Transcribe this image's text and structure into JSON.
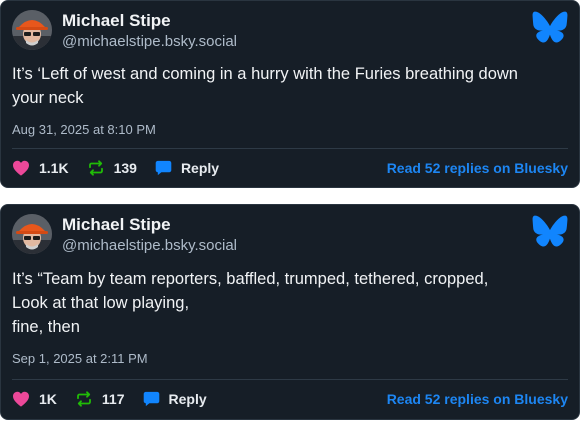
{
  "colors": {
    "card_background": "#161e27",
    "text": "#f1f3f5",
    "muted": "#aebbc9",
    "like": "#ec4899",
    "repost": "#20bc07",
    "reply": "#1185fe",
    "link": "#1d86f3",
    "bluesky_logo": "#1185fe"
  },
  "posts": [
    {
      "author": {
        "name": "Michael Stipe",
        "handle": "@michaelstipe.bsky.social"
      },
      "text_lines": [
        "It’s ‘Left of west and coming in a hurry with the Furies breathing down",
        "your neck"
      ],
      "timestamp": "Aug 31, 2025 at 8:10 PM",
      "likes": "1.1K",
      "reposts": "139",
      "reply_label": "Reply",
      "read_replies": "Read 52 replies on Bluesky",
      "icons": [
        "heart-icon",
        "repost-icon",
        "reply-icon",
        "bluesky-butterfly-icon"
      ]
    },
    {
      "author": {
        "name": "Michael Stipe",
        "handle": "@michaelstipe.bsky.social"
      },
      "text_lines": [
        "It’s “Team by team reporters, baffled, trumped, tethered, cropped,",
        "Look at that low playing,",
        "fine, then"
      ],
      "timestamp": "Sep 1, 2025 at 2:11 PM",
      "likes": "1K",
      "reposts": "117",
      "reply_label": "Reply",
      "read_replies": "Read 52 replies on Bluesky",
      "icons": [
        "heart-icon",
        "repost-icon",
        "reply-icon",
        "bluesky-butterfly-icon"
      ]
    }
  ]
}
